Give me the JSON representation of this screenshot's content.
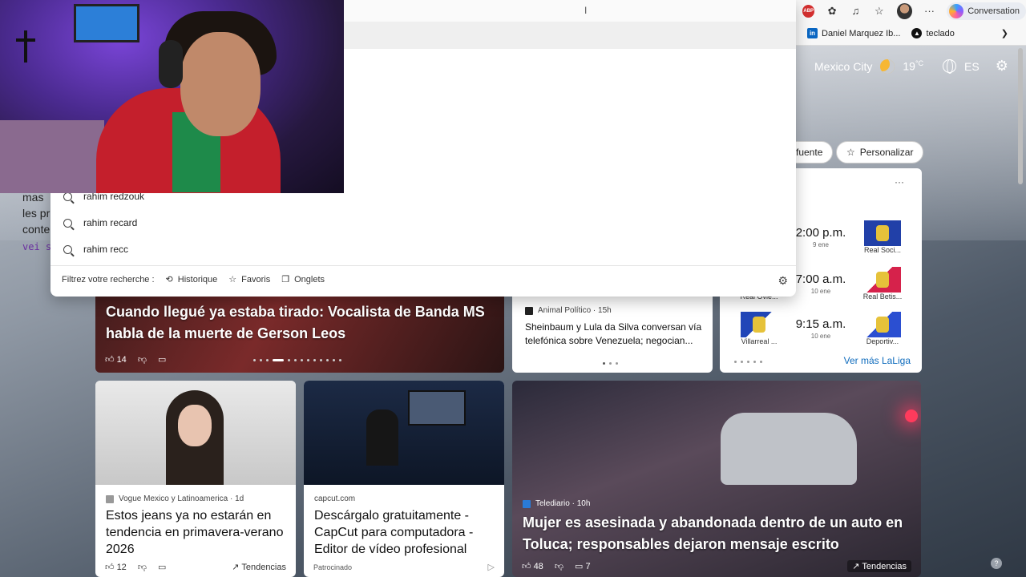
{
  "toolbar": {
    "abp_label": "ABP",
    "copilot_label": "Conversation"
  },
  "bookmarks": [
    {
      "label": "Daniel Marquez Ib..."
    },
    {
      "label": "teclado"
    }
  ],
  "weather": {
    "city": "Mexico City",
    "temp": "19",
    "unit": "°C",
    "lang": "ES"
  },
  "chips": {
    "source": "fuente",
    "personalize": "Personalizar"
  },
  "address_dropdown": {
    "suggestions": [
      "rahim redzouk",
      "rahim recard",
      "rahim recc"
    ],
    "filter_label": "Filtrez votre recherche :",
    "filters": [
      "Historique",
      "Favoris",
      "Onglets"
    ]
  },
  "stream_text": {
    "line1": "mas",
    "line2": "les pr",
    "line3": "conten",
    "line4": "vei sta"
  },
  "sports": {
    "more_icon": "···",
    "matches": [
      {
        "home": "",
        "time": "2:00 p.m.",
        "date": "9 ene",
        "away": "Real Soci..."
      },
      {
        "home": "Real Ovie...",
        "time": "7:00 a.m.",
        "date": "10 ene",
        "away": "Real Betis..."
      },
      {
        "home": "Villarreal ...",
        "time": "9:15 a.m.",
        "date": "10 ene",
        "away": "Deportiv..."
      }
    ],
    "see_more": "Ver más LaLiga"
  },
  "hero_card": {
    "title": "Cuando llegué ya estaba tirado: Vocalista de Banda MS habla de la muerte de Gerson Leos",
    "likes": "14"
  },
  "news_card_small": {
    "source": "Animal Político · 15h",
    "title": "Sheinbaum y Lula da Silva conversan vía telefónica sobre Venezuela; negocian..."
  },
  "card_vogue": {
    "source": "Vogue Mexico y Latinoamerica · 1d",
    "title": "Estos jeans ya no estarán en tendencia en primavera-verano 2026",
    "likes": "12",
    "trend": "Tendencias"
  },
  "card_capcut": {
    "source": "capcut.com",
    "title": "Descárgalo gratuitamente - CapCut para computadora - Editor de vídeo profesional",
    "sponsored": "Patrocinado"
  },
  "card_telediario": {
    "source": "Telediario · 10h",
    "title": "Mujer es asesinada y abandonada dentro de un auto en Toluca; responsables dejaron mensaje escrito",
    "likes": "48",
    "comments": "7",
    "trend": "Tendencias"
  },
  "help_label": "?"
}
